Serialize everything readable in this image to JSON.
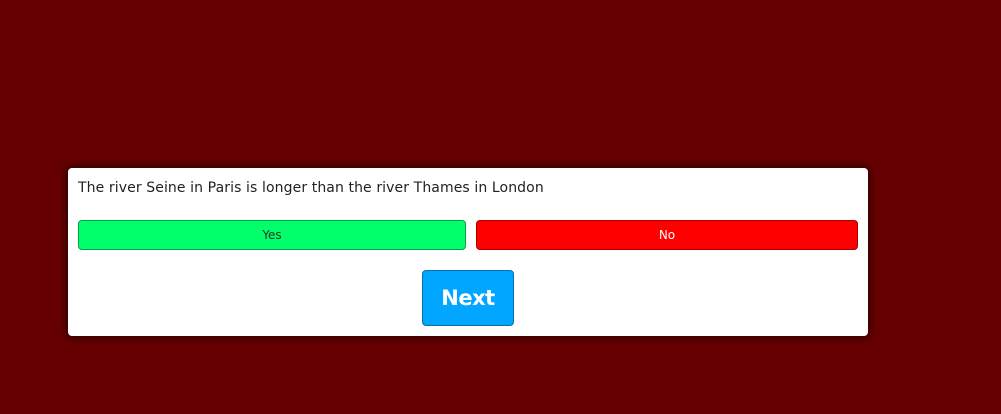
{
  "page": {
    "background_color": "#660000"
  },
  "quiz": {
    "question": "The river Seine in Paris is longer than the river Thames in London",
    "answers": [
      {
        "label": "Yes",
        "color": "#00ff6a"
      },
      {
        "label": "No",
        "color": "#ff0000"
      }
    ],
    "next_label": "Next",
    "next_color": "#00a6ff"
  }
}
